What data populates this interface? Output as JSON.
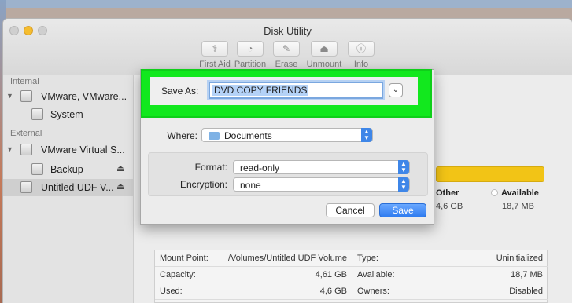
{
  "window": {
    "title": "Disk Utility"
  },
  "toolbar": {
    "items": [
      {
        "label": "First Aid",
        "icon": "first-aid-icon"
      },
      {
        "label": "Partition",
        "icon": "partition-icon"
      },
      {
        "label": "Erase",
        "icon": "erase-icon"
      },
      {
        "label": "Unmount",
        "icon": "unmount-icon"
      },
      {
        "label": "Info",
        "icon": "info-icon"
      }
    ]
  },
  "sidebar": {
    "internal_header": "Internal",
    "external_header": "External",
    "items": [
      {
        "label": "VMware, VMware..."
      },
      {
        "label": "System"
      },
      {
        "label": "VMware Virtual S..."
      },
      {
        "label": "Backup"
      },
      {
        "label": "Untitled UDF V..."
      }
    ]
  },
  "usage": {
    "bar_color": "#f2c416",
    "other_label": "Other",
    "other_size": "4,6 GB",
    "available_label": "Available",
    "available_size": "18,7 MB"
  },
  "info_table": {
    "left": [
      {
        "key": "Mount Point:",
        "value": "/Volumes/Untitled UDF Volume"
      },
      {
        "key": "Capacity:",
        "value": "4,61 GB"
      },
      {
        "key": "Used:",
        "value": "4,6 GB"
      }
    ],
    "right": [
      {
        "key": "Type:",
        "value": "Uninitialized"
      },
      {
        "key": "Available:",
        "value": "18,7 MB"
      },
      {
        "key": "Owners:",
        "value": "Disabled"
      }
    ]
  },
  "dialog": {
    "save_as_label": "Save As:",
    "save_as_value": "DVD COPY FRIENDS",
    "where_label": "Where:",
    "where_value": "Documents",
    "format_label": "Format:",
    "format_value": "read-only",
    "encryption_label": "Encryption:",
    "encryption_value": "none",
    "cancel_label": "Cancel",
    "save_label": "Save",
    "highlight_color": "#12e81e",
    "accent_color": "#3e86e8"
  }
}
